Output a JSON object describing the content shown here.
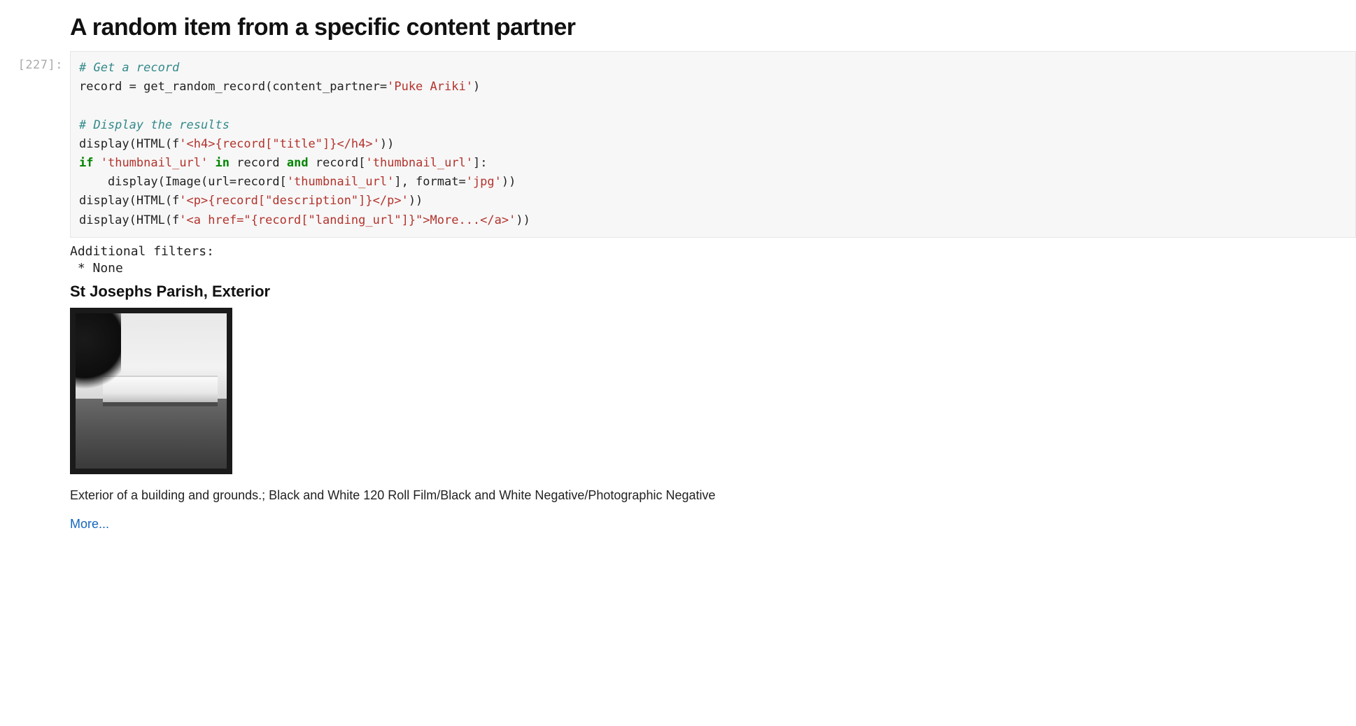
{
  "section_title": "A random item from a specific content partner",
  "cell": {
    "prompt": "[227]:",
    "code": {
      "line1_comment": "# Get a record",
      "line2_pre": "record = get_random_record(content_partner=",
      "line2_str": "'Puke Ariki'",
      "line2_post": ")",
      "line4_comment": "# Display the results",
      "line5_pre": "display(HTML(f",
      "line5_str": "'<h4>{record[\"title\"]}</h4>'",
      "line5_post": "))",
      "line6_kw1": "if",
      "line6_mid1": " ",
      "line6_str1": "'thumbnail_url'",
      "line6_mid2": " ",
      "line6_kw2": "in",
      "line6_mid3": " record ",
      "line6_kw3": "and",
      "line6_mid4": " record[",
      "line6_str2": "'thumbnail_url'",
      "line6_post": "]:",
      "line7_pre": "    display(Image(url=record[",
      "line7_str1": "'thumbnail_url'",
      "line7_mid": "], format=",
      "line7_str2": "'jpg'",
      "line7_post": "))",
      "line8_pre": "display(HTML(f",
      "line8_str": "'<p>{record[\"description\"]}</p>'",
      "line8_post": "))",
      "line9_pre": "display(HTML(f",
      "line9_str": "'<a href=\"{record[\"landing_url\"]}\">More...</a>'",
      "line9_post": "))"
    }
  },
  "output": {
    "stdout": "Additional filters:\n * None",
    "title": "St Josephs Parish, Exterior",
    "description": "Exterior of a building and grounds.; Black and White 120 Roll Film/Black and White Negative/Photographic Negative",
    "more_label": "More..."
  }
}
